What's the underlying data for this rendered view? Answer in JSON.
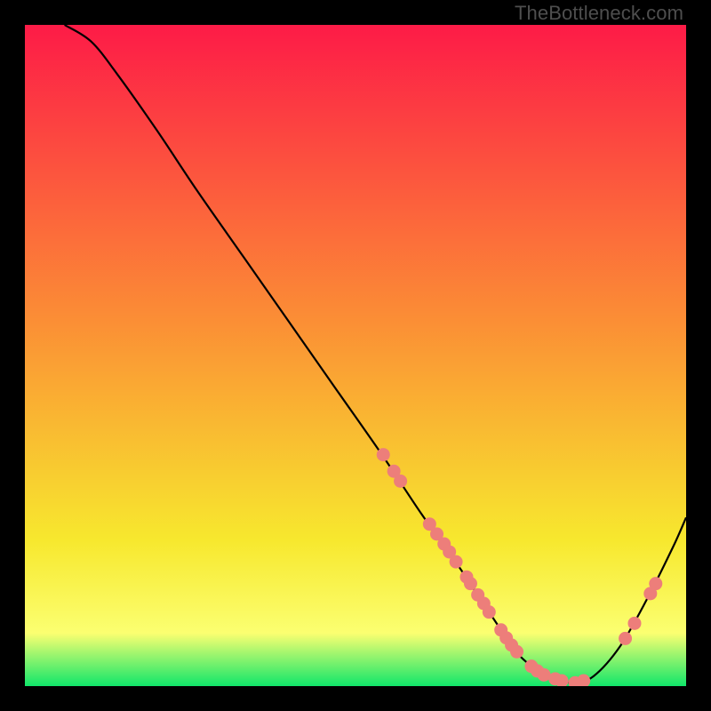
{
  "watermark": "TheBottleneck.com",
  "colors": {
    "gradient_top": "#fd1b47",
    "gradient_mid1": "#fb8f35",
    "gradient_mid2": "#f7e82e",
    "gradient_mid3": "#fbff71",
    "gradient_bottom": "#11e66a",
    "line": "#000000",
    "point_fill": "#ed7e7a",
    "background": "#000000"
  },
  "chart_data": {
    "type": "line",
    "title": "",
    "xlabel": "",
    "ylabel": "",
    "xlim": [
      0,
      100
    ],
    "ylim": [
      0,
      100
    ],
    "series": [
      {
        "name": "curve",
        "x": [
          6,
          10,
          14,
          20,
          26,
          33,
          40,
          47,
          54,
          60,
          65,
          69,
          72,
          74,
          76,
          78,
          80,
          83,
          86,
          90,
          94,
          98,
          100
        ],
        "y": [
          100,
          97.5,
          92.5,
          84,
          75,
          65,
          55,
          45,
          35,
          26,
          19,
          13,
          8.5,
          5.5,
          3.5,
          2.1,
          1.2,
          0.5,
          1.5,
          6,
          13,
          21,
          25.5
        ]
      }
    ],
    "scatter_points": [
      {
        "x": 54.2,
        "y": 35.0
      },
      {
        "x": 55.8,
        "y": 32.5
      },
      {
        "x": 56.8,
        "y": 31.0
      },
      {
        "x": 61.2,
        "y": 24.5
      },
      {
        "x": 62.3,
        "y": 23.0
      },
      {
        "x": 63.4,
        "y": 21.5
      },
      {
        "x": 64.2,
        "y": 20.3
      },
      {
        "x": 65.2,
        "y": 18.8
      },
      {
        "x": 66.8,
        "y": 16.5
      },
      {
        "x": 67.4,
        "y": 15.5
      },
      {
        "x": 68.5,
        "y": 13.8
      },
      {
        "x": 69.4,
        "y": 12.5
      },
      {
        "x": 70.2,
        "y": 11.2
      },
      {
        "x": 72.0,
        "y": 8.5
      },
      {
        "x": 72.8,
        "y": 7.3
      },
      {
        "x": 73.6,
        "y": 6.2
      },
      {
        "x": 74.4,
        "y": 5.2
      },
      {
        "x": 76.6,
        "y": 3.0
      },
      {
        "x": 77.5,
        "y": 2.3
      },
      {
        "x": 78.5,
        "y": 1.7
      },
      {
        "x": 80.2,
        "y": 1.1
      },
      {
        "x": 81.2,
        "y": 0.8
      },
      {
        "x": 83.2,
        "y": 0.5
      },
      {
        "x": 84.5,
        "y": 0.8
      },
      {
        "x": 90.8,
        "y": 7.2
      },
      {
        "x": 92.2,
        "y": 9.5
      },
      {
        "x": 94.6,
        "y": 14.0
      },
      {
        "x": 95.4,
        "y": 15.5
      }
    ],
    "gradient_bands": [
      {
        "pos": 0.0,
        "color_key": "gradient_top"
      },
      {
        "pos": 0.45,
        "color_key": "gradient_mid1"
      },
      {
        "pos": 0.78,
        "color_key": "gradient_mid2"
      },
      {
        "pos": 0.92,
        "color_key": "gradient_mid3"
      },
      {
        "pos": 1.0,
        "color_key": "gradient_bottom"
      }
    ]
  }
}
